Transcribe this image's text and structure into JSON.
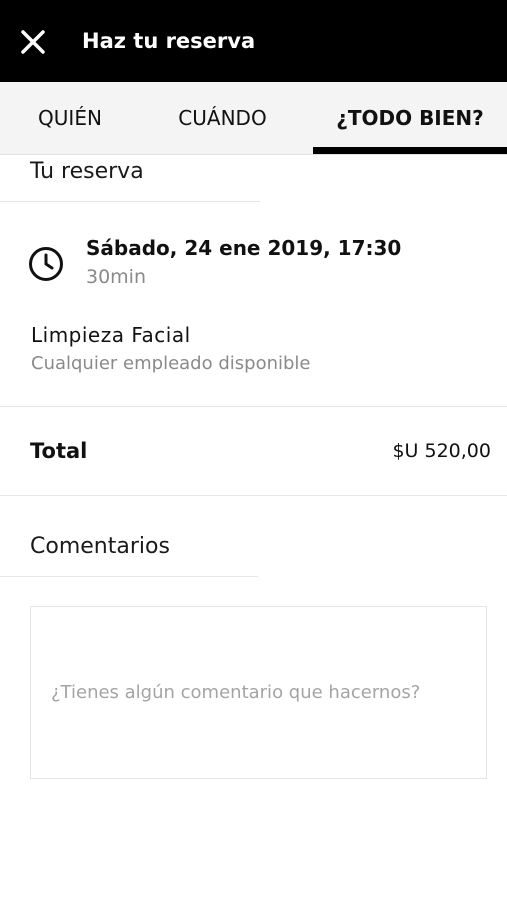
{
  "header": {
    "title": "Haz tu reserva",
    "close_icon": "close-icon"
  },
  "tabs": [
    {
      "label": "QUIÉN",
      "active": false
    },
    {
      "label": "CUÁNDO",
      "active": false
    },
    {
      "label": "¿TODO BIEN?",
      "active": true
    }
  ],
  "booking": {
    "section_title": "Tu reserva",
    "date_time": "Sábado, 24 ene 2019, 17:30",
    "duration": "30min",
    "service": "Limpieza Facial",
    "employee": "Cualquier empleado disponible",
    "icon": "clock-icon"
  },
  "total": {
    "label": "Total",
    "value": "$U 520,00"
  },
  "comments": {
    "section_title": "Comentarios",
    "placeholder": "¿Tienes algún comentario que hacernos?",
    "value": ""
  },
  "colors": {
    "header_bg": "#000000",
    "tabs_bg": "#f4f4f4",
    "active_indicator": "#000000",
    "muted_text": "#8a8a8a"
  }
}
